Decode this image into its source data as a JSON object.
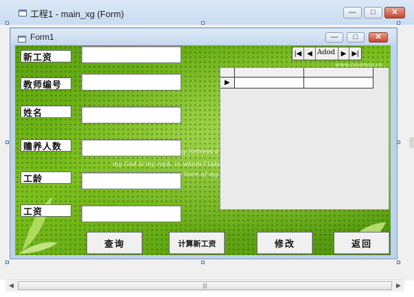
{
  "outer_window": {
    "title": "工程1 - main_xg (Form)",
    "min_glyph": "—",
    "max_glyph": "□",
    "close_glyph": "✕"
  },
  "form": {
    "title": "Form1",
    "min_glyph": "—",
    "max_glyph": "□",
    "close_glyph": "✕"
  },
  "fields": [
    {
      "label": "新工资",
      "value": ""
    },
    {
      "label": "教师编号",
      "value": ""
    },
    {
      "label": "姓名",
      "value": ""
    },
    {
      "label": "赡养人数",
      "value": ""
    },
    {
      "label": "工龄",
      "value": ""
    },
    {
      "label": "工资",
      "value": ""
    }
  ],
  "buttons": {
    "query": "查询",
    "calc": "计算新工资",
    "modify": "修改",
    "back": "返回"
  },
  "adodc": {
    "caption": "Adod",
    "first": "|◀",
    "prev": "◀",
    "next": "▶",
    "last": "▶|"
  },
  "background_text": {
    "line1": "my fortress a",
    "line2": "my God is my rock, in whom I take",
    "line3": "e horn of my",
    "watermark": "www.csxsmap.co"
  },
  "grid": {
    "row_marker": "▶"
  },
  "scrollbar": {
    "left_glyph": "◀",
    "right_glyph": "▶",
    "thumb_glyph": "|||"
  },
  "colors": {
    "background_green": "#4f9a0c",
    "selection_handle": "#2d6fd0",
    "close_red": "#c8442c"
  }
}
